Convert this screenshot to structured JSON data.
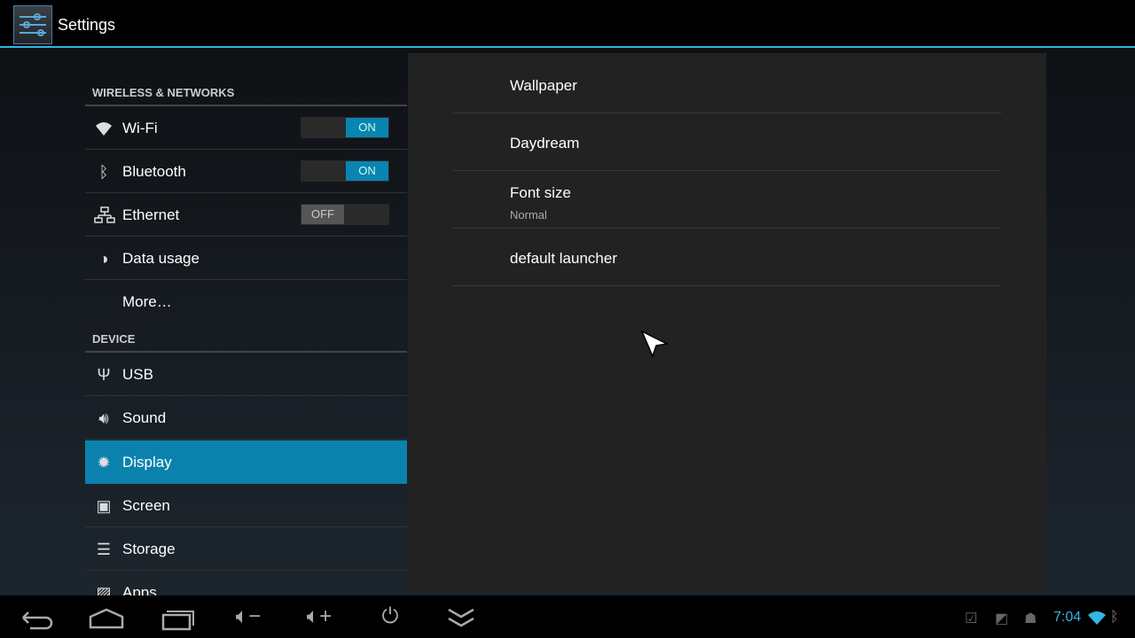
{
  "app": {
    "title": "Settings",
    "icon": "settings-sliders-icon"
  },
  "left": {
    "sections": [
      {
        "header": "WIRELESS & NETWORKS"
      },
      {
        "header": "DEVICE"
      }
    ],
    "items": [
      {
        "label": "Wi-Fi",
        "icon": "wifi-icon",
        "toggle": "ON"
      },
      {
        "label": "Bluetooth",
        "icon": "bluetooth-icon",
        "toggle": "ON"
      },
      {
        "label": "Ethernet",
        "icon": "ethernet-icon",
        "toggle": "OFF"
      },
      {
        "label": "Data usage",
        "icon": "data-usage-icon"
      },
      {
        "label": "More…"
      },
      {
        "label": "USB",
        "icon": "usb-icon"
      },
      {
        "label": "Sound",
        "icon": "sound-icon"
      },
      {
        "label": "Display",
        "icon": "display-brightness-icon",
        "selected": true
      },
      {
        "label": "Screen",
        "icon": "screen-icon"
      },
      {
        "label": "Storage",
        "icon": "storage-icon"
      },
      {
        "label": "Apps",
        "icon": "apps-icon"
      }
    ]
  },
  "right": {
    "items": [
      {
        "title": "Wallpaper"
      },
      {
        "title": "Daydream"
      },
      {
        "title": "Font size",
        "summary": "Normal"
      },
      {
        "title": "default launcher"
      }
    ]
  },
  "navbar": {
    "buttons": [
      "back-icon",
      "home-icon",
      "recent-apps-icon",
      "volume-down-icon",
      "volume-up-icon",
      "power-icon",
      "collapse-icon"
    ]
  },
  "status": {
    "time": "7:04",
    "icons": [
      "notification-check-icon",
      "notification-image-icon",
      "android-icon",
      "wifi-icon",
      "bluetooth-icon"
    ]
  },
  "colors": {
    "accent": "#33b5e5",
    "selected": "#0a82ad",
    "toggle_on": "#0a84b0"
  }
}
